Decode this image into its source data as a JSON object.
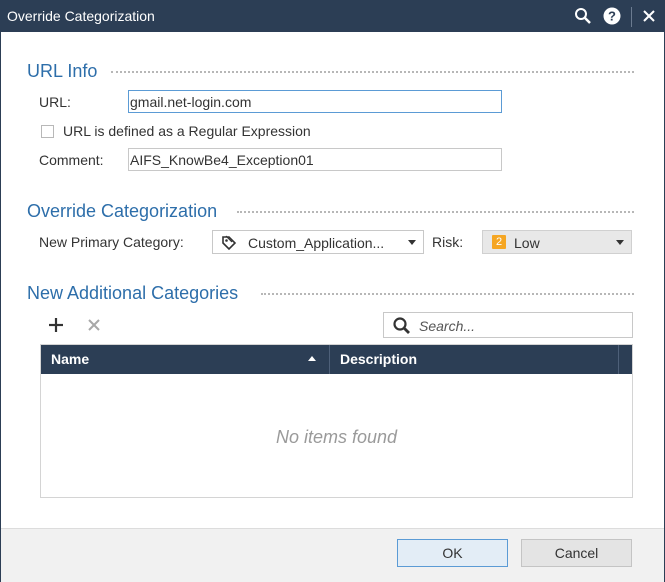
{
  "window": {
    "title": "Override Categorization",
    "icons": [
      "search-icon",
      "help-icon",
      "close-icon"
    ]
  },
  "url_info": {
    "section_title": "URL Info",
    "url_label": "URL:",
    "url_value": "gmail.net-login.com",
    "regex_label": "URL is defined as a Regular Expression",
    "regex_checked": false,
    "comment_label": "Comment:",
    "comment_value": "AIFS_KnowBe4_Exception01"
  },
  "override": {
    "section_title": "Override Categorization",
    "primary_label": "New Primary Category:",
    "primary_value": "Custom_Application...",
    "risk_label": "Risk:",
    "risk_level": "2",
    "risk_value": "Low"
  },
  "additional": {
    "section_title": "New Additional Categories",
    "search_placeholder": "Search...",
    "columns": [
      "Name",
      "Description"
    ],
    "empty_text": "No items found"
  },
  "footer": {
    "ok_label": "OK",
    "cancel_label": "Cancel"
  },
  "colors": {
    "titlebar": "#2c3e55",
    "section_title": "#2d6eaa",
    "risk_badge": "#f5a623"
  }
}
